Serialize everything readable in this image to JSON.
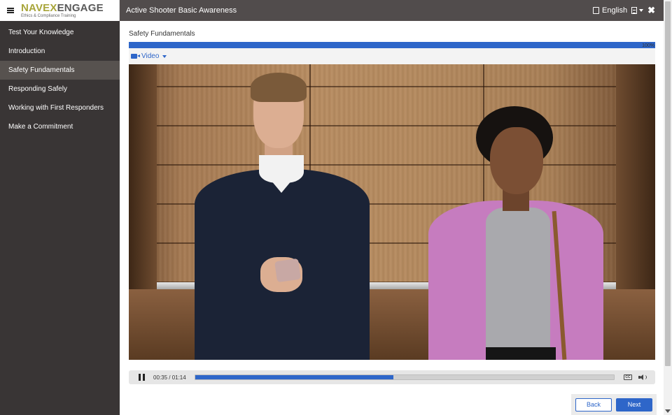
{
  "logo": {
    "part1": "NAVEX",
    "part2": "ENGAGE",
    "tagline": "Ethics & Compliance Training"
  },
  "course": {
    "title": "Active Shooter Basic Awareness"
  },
  "header": {
    "language": "English"
  },
  "sidebar": {
    "items": [
      {
        "label": "Test Your Knowledge"
      },
      {
        "label": "Introduction"
      },
      {
        "label": "Safety Fundamentals"
      },
      {
        "label": "Responding Safely"
      },
      {
        "label": "Working with First Responders"
      },
      {
        "label": "Make a Commitment"
      }
    ],
    "active_index": 2
  },
  "section": {
    "title": "Safety Fundamentals"
  },
  "progress": {
    "percent": 100,
    "label": "100%"
  },
  "media": {
    "type_label": "Video"
  },
  "player": {
    "time": "00:35 / 01:14",
    "position_fraction": 0.473,
    "cc_label": "CC"
  },
  "footer": {
    "back_label": "Back",
    "next_label": "Next"
  },
  "colors": {
    "accent": "#2e66c9",
    "sidebar_bg": "#393535",
    "header_bg": "#514c4c",
    "logo_green": "#a8a53a"
  }
}
